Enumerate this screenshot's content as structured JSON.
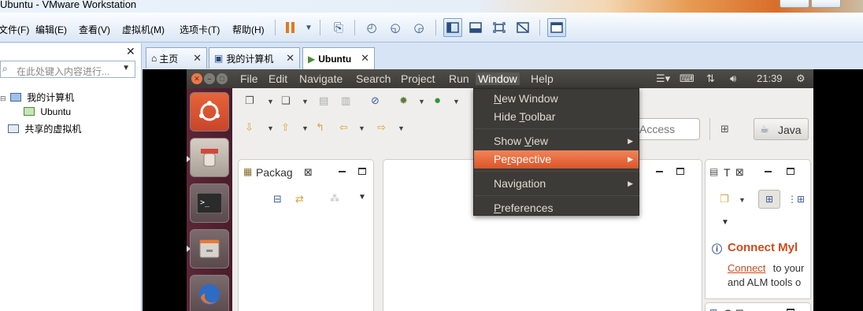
{
  "window": {
    "title": "Ubuntu - VMware Workstation"
  },
  "vmware_menu": [
    "文件(F)",
    "编辑(E)",
    "查看(V)",
    "虚拟机(M)",
    "选项卡(T)",
    "帮助(H)"
  ],
  "library": {
    "search_placeholder": "在此处键入内容进行...",
    "tree": {
      "my_computer": "我的计算机",
      "vm": "Ubuntu",
      "shared": "共享的虚拟机"
    }
  },
  "tabs": [
    {
      "label": "主页"
    },
    {
      "label": "我的计算机"
    },
    {
      "label": "Ubuntu"
    }
  ],
  "ubuntu_panel": {
    "menus": [
      "File",
      "Edit",
      "Navigate",
      "Search",
      "Project",
      "Run",
      "Window",
      "Help"
    ],
    "open_menu": "Window",
    "clock": "21:39"
  },
  "eclipse": {
    "quick_access": "Access",
    "perspective": "Java",
    "package_view": "Packag",
    "task_view": "T",
    "outline_view": "O",
    "mylyn": {
      "title": "Connect Myl",
      "link": "Connect",
      "line1_rest": " to your",
      "line2": "and ALM tools o"
    }
  },
  "window_menu": [
    {
      "mnemonic": "N",
      "rest": "ew Window",
      "submenu": false
    },
    {
      "pre": "Hide ",
      "mnemonic": "T",
      "rest": "oolbar",
      "submenu": false
    },
    {
      "pre": "Show ",
      "mnemonic": "V",
      "rest": "iew",
      "submenu": true
    },
    {
      "pre": "Pe",
      "mnemonic": "r",
      "rest": "spective",
      "submenu": true,
      "highlighted": true
    },
    {
      "label": "Navigation",
      "submenu": true
    },
    {
      "mnemonic": "P",
      "rest": "references",
      "submenu": false
    }
  ]
}
